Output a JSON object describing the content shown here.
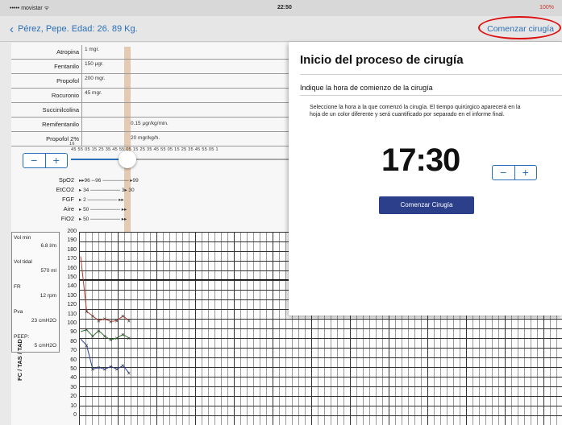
{
  "status_bar": {
    "carrier": "••••• movistar ᯤ",
    "time": "22:50",
    "battery": "100%"
  },
  "nav": {
    "back_label": "Pérez, Pepe. Edad: 26. 89 Kg.",
    "action_label": "Comenzar cirugía"
  },
  "drugs": [
    {
      "name": "Atropina",
      "dose": "1 mgr.",
      "infusion": ""
    },
    {
      "name": "Fentanilo",
      "dose": "150 μgr.",
      "infusion": ""
    },
    {
      "name": "Propofol",
      "dose": "200 mgr.",
      "infusion": ""
    },
    {
      "name": "Rocuronio",
      "dose": "45 mgr.",
      "infusion": ""
    },
    {
      "name": "Succinilcolina",
      "dose": "",
      "infusion": ""
    },
    {
      "name": "Remifentanilo",
      "dose": "",
      "infusion": "0.15 μgr/kg/min."
    },
    {
      "name": "Propofol 2%",
      "dose": "",
      "infusion": "20 mgr/kg/h."
    }
  ],
  "timeline": {
    "hour": "16",
    "ticks": "45 55 05 15 25 35 45 55 05 15 25 35 45 55 05 15 25 35 45 55 05 1"
  },
  "vitals": [
    {
      "name": "SpO2",
      "values": "▸▸96 ─96 ─────── ▸99"
    },
    {
      "name": "EtCO2",
      "values": "▸ 34 ──────── 3▸ 30"
    },
    {
      "name": "FGF",
      "values": "▸ 2 ──────── ▸▸"
    },
    {
      "name": "Aire",
      "values": "▸ 50 ──────── ▸▸"
    },
    {
      "name": "FiO2",
      "values": "▸ 50 ──────── ▸▸"
    }
  ],
  "params": [
    {
      "label": "Vol min",
      "value": "6.8 l/m"
    },
    {
      "label": "Vol tidal",
      "value": "570 ml"
    },
    {
      "label": "FR",
      "value": "12 rpm"
    },
    {
      "label": "Pva",
      "value": "23 cmH2O"
    },
    {
      "label": "PEEP:",
      "value": "5 cmH2O"
    }
  ],
  "y_axis": {
    "title": "FC / TAS / TAD",
    "ticks": [
      200,
      190,
      180,
      170,
      160,
      150,
      140,
      130,
      120,
      110,
      100,
      90,
      80,
      70,
      60,
      50,
      40,
      30,
      20,
      10,
      0
    ]
  },
  "panel": {
    "title": "Inicio del proceso de cirugía",
    "prompt": "Indique la hora de comienzo de la cirugía",
    "description": "Seleccione la hora a la que comenzó la cirugía. El tiempo quirúrgico aparecerá en la hoja de un color diferente y será cuantificado por separado en el informe final.",
    "time": "17:30",
    "button_label": "Comenzar Cirugía"
  },
  "colors": {
    "accent": "#2a6fb8",
    "button": "#2c3f8a",
    "highlight_ring": "#dd1111",
    "surgery_bar": "#d5a578",
    "series_red": "#b33a2a",
    "series_green": "#2f7a2f",
    "series_blue": "#2a3f9e"
  },
  "chart_data": {
    "type": "line",
    "y_range": [
      0,
      200
    ],
    "series": [
      {
        "values": [
          175,
          115,
          110,
          105,
          107,
          104,
          105,
          110,
          105
        ]
      },
      {
        "values": [
          93,
          95,
          88,
          94,
          88,
          84,
          86,
          90,
          86
        ]
      },
      {
        "values": [
          85,
          78,
          52,
          54,
          52,
          55,
          52,
          56,
          48
        ]
      }
    ]
  }
}
